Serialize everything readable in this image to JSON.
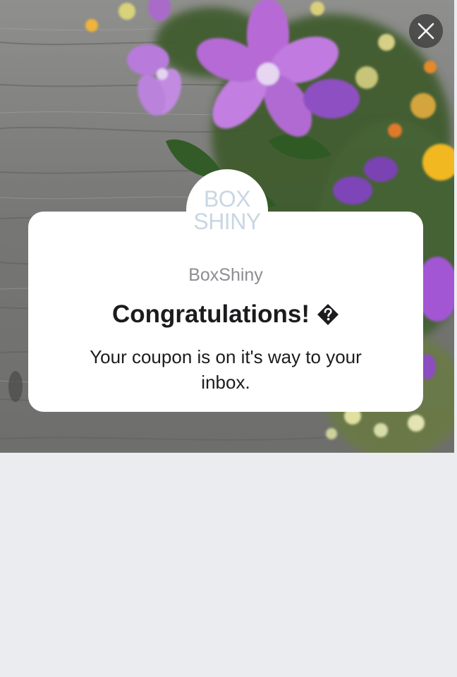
{
  "popup": {
    "brand_name": "BoxShiny",
    "title": "Congratulations!",
    "message": "Your coupon is on it's way to your inbox.",
    "logo_lines": [
      "BOX",
      "SHINY"
    ]
  },
  "icons": {
    "close": "close-icon",
    "title_glyph": "replacement-character-icon"
  },
  "colors": {
    "page_background": "#ebecf0",
    "card_background": "#ffffff",
    "title_text": "#1c1c1e",
    "brand_text": "#8d8d92",
    "logo_text": "#c9d6e3",
    "close_button": "#282828"
  }
}
